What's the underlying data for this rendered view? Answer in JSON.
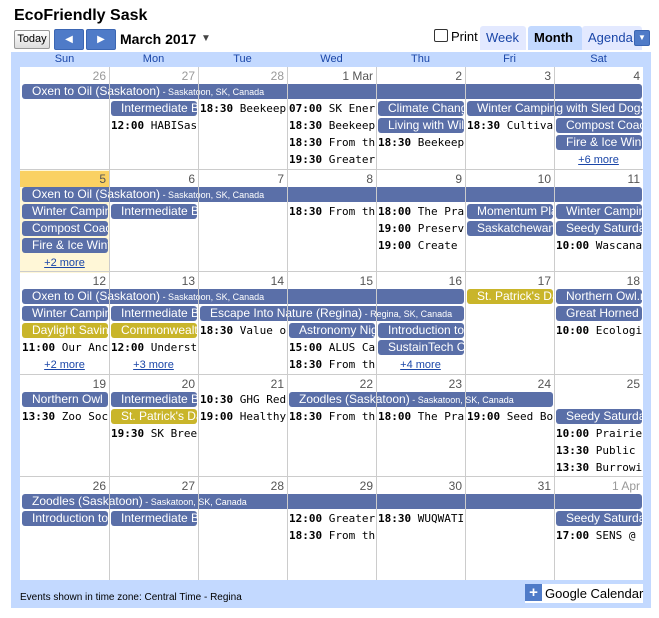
{
  "header": {
    "title": "EcoFriendly Sask"
  },
  "toolbar": {
    "today_label": "Today",
    "prev_icon": "◀",
    "next_icon": "▶",
    "current_period": "March 2017",
    "period_dropdown_icon": "▼",
    "print_label": "Print",
    "tabs": {
      "week": "Week",
      "month": "Month",
      "agenda": "Agenda"
    },
    "view_dropdown_icon": "▼"
  },
  "weekdays": [
    "Sun",
    "Mon",
    "Tue",
    "Wed",
    "Thu",
    "Fri",
    "Sat"
  ],
  "weeks": [
    {
      "days": [
        "26",
        "27",
        "28",
        "1 Mar",
        "2",
        "3",
        "4"
      ],
      "other_month": [
        true,
        true,
        true,
        false,
        false,
        false,
        false
      ],
      "today_index": -1,
      "items": [
        {
          "kind": "bar",
          "col": 0,
          "span": 7,
          "row": 0,
          "title": "Oxen to Oil (Saskatoon)",
          "loc": " - Saskatoon, SK, Canada",
          "color": "blue"
        },
        {
          "kind": "bar",
          "col": 1,
          "span": 1,
          "row": 1,
          "title": "Intermediate Beekeeping",
          "color": "blue"
        },
        {
          "kind": "time",
          "col": 2,
          "row": 1,
          "time": "18:30",
          "text": "Beekeeping"
        },
        {
          "kind": "time",
          "col": 3,
          "row": 1,
          "time": "07:00",
          "text": "SK Energy"
        },
        {
          "kind": "bar",
          "col": 4,
          "span": 1,
          "row": 1,
          "title": "Climate Change",
          "color": "blue"
        },
        {
          "kind": "bar",
          "col": 5,
          "span": 2,
          "row": 1,
          "title": "Winter Camping with Sled Dogs",
          "color": "blue"
        },
        {
          "kind": "time",
          "col": 1,
          "row": 2,
          "time": "12:00",
          "text": "HABISask"
        },
        {
          "kind": "time",
          "col": 3,
          "row": 2,
          "time": "18:30",
          "text": "Beekeeping"
        },
        {
          "kind": "bar",
          "col": 4,
          "span": 1,
          "row": 2,
          "title": "Living with Wildlife",
          "color": "blue"
        },
        {
          "kind": "time",
          "col": 5,
          "row": 2,
          "time": "18:30",
          "text": "Cultivating"
        },
        {
          "kind": "bar",
          "col": 6,
          "span": 1,
          "row": 2,
          "title": "Compost Coaching",
          "color": "blue"
        },
        {
          "kind": "time",
          "col": 3,
          "row": 3,
          "time": "18:30",
          "text": "From the"
        },
        {
          "kind": "time",
          "col": 4,
          "row": 3,
          "time": "18:30",
          "text": "Beekeeping"
        },
        {
          "kind": "bar",
          "col": 6,
          "span": 1,
          "row": 3,
          "title": "Fire & Ice Winter",
          "color": "blue"
        },
        {
          "kind": "time",
          "col": 3,
          "row": 4,
          "time": "19:30",
          "text": "Greater S"
        },
        {
          "kind": "more",
          "col": 6,
          "row": 4,
          "text": "+6 more"
        }
      ]
    },
    {
      "days": [
        "5",
        "6",
        "7",
        "8",
        "9",
        "10",
        "11"
      ],
      "other_month": [
        false,
        false,
        false,
        false,
        false,
        false,
        false
      ],
      "today_index": 0,
      "items": [
        {
          "kind": "bar",
          "col": 0,
          "span": 7,
          "row": 0,
          "title": "Oxen to Oil (Saskatoon)",
          "loc": " - Saskatoon, SK, Canada",
          "color": "blue"
        },
        {
          "kind": "bar",
          "col": 0,
          "span": 1,
          "row": 1,
          "title": "Winter Camping",
          "color": "blue"
        },
        {
          "kind": "bar",
          "col": 1,
          "span": 1,
          "row": 1,
          "title": "Intermediate Beekeeping",
          "color": "blue"
        },
        {
          "kind": "time",
          "col": 3,
          "row": 1,
          "time": "18:30",
          "text": "From the"
        },
        {
          "kind": "time",
          "col": 4,
          "row": 1,
          "time": "18:00",
          "text": "The Prairie"
        },
        {
          "kind": "bar",
          "col": 5,
          "span": 1,
          "row": 1,
          "title": "Momentum Planet",
          "color": "blue"
        },
        {
          "kind": "bar",
          "col": 6,
          "span": 1,
          "row": 1,
          "title": "Winter Camping",
          "color": "blue"
        },
        {
          "kind": "bar",
          "col": 0,
          "span": 1,
          "row": 2,
          "title": "Compost Coaching",
          "color": "blue"
        },
        {
          "kind": "time",
          "col": 4,
          "row": 2,
          "time": "19:00",
          "text": "Preserving"
        },
        {
          "kind": "bar",
          "col": 5,
          "span": 1,
          "row": 2,
          "title": "Saskatchewan",
          "color": "blue"
        },
        {
          "kind": "bar",
          "col": 6,
          "span": 1,
          "row": 2,
          "title": "Seedy Saturday",
          "color": "blue"
        },
        {
          "kind": "bar",
          "col": 0,
          "span": 1,
          "row": 3,
          "title": "Fire & Ice Winter",
          "color": "blue"
        },
        {
          "kind": "time",
          "col": 4,
          "row": 3,
          "time": "19:00",
          "text": "Create a Po"
        },
        {
          "kind": "time",
          "col": 6,
          "row": 3,
          "time": "10:00",
          "text": "Wascana Wi"
        },
        {
          "kind": "more",
          "col": 0,
          "row": 4,
          "text": "+2 more"
        }
      ]
    },
    {
      "days": [
        "12",
        "13",
        "14",
        "15",
        "16",
        "17",
        "18"
      ],
      "other_month": [
        false,
        false,
        false,
        false,
        false,
        false,
        false
      ],
      "today_index": -1,
      "items": [
        {
          "kind": "bar",
          "col": 0,
          "span": 5,
          "row": 0,
          "title": "Oxen to Oil (Saskatoon)",
          "loc": " - Saskatoon, SK, Canada",
          "color": "blue"
        },
        {
          "kind": "bar",
          "col": 5,
          "span": 1,
          "row": 0,
          "title": "St. Patrick's Day",
          "color": "gold"
        },
        {
          "kind": "bar",
          "col": 6,
          "span": 1,
          "row": 0,
          "title": "Northern Owl.ne",
          "color": "blue"
        },
        {
          "kind": "bar",
          "col": 0,
          "span": 1,
          "row": 1,
          "title": "Winter Camping",
          "color": "blue"
        },
        {
          "kind": "bar",
          "col": 1,
          "span": 1,
          "row": 1,
          "title": "Intermediate Beekeeping",
          "color": "blue"
        },
        {
          "kind": "bar",
          "col": 2,
          "span": 3,
          "row": 1,
          "title": "Escape Into Nature (Regina)",
          "loc": " - Regina, SK, Canada",
          "color": "blue"
        },
        {
          "kind": "bar",
          "col": 6,
          "span": 1,
          "row": 1,
          "title": "Great Horned Owl",
          "color": "blue"
        },
        {
          "kind": "bar",
          "col": 0,
          "span": 1,
          "row": 2,
          "title": "Daylight Saving Time",
          "color": "gold"
        },
        {
          "kind": "bar",
          "col": 1,
          "span": 1,
          "row": 2,
          "title": "Commonwealth Day",
          "color": "gold"
        },
        {
          "kind": "time",
          "col": 2,
          "row": 2,
          "time": "18:30",
          "text": "Value of W"
        },
        {
          "kind": "bar",
          "col": 3,
          "span": 1,
          "row": 2,
          "title": "Astronomy Night",
          "color": "blue"
        },
        {
          "kind": "bar",
          "col": 4,
          "span": 1,
          "row": 2,
          "title": "Introduction to",
          "color": "blue"
        },
        {
          "kind": "time",
          "col": 6,
          "row": 2,
          "time": "10:00",
          "text": "Ecological"
        },
        {
          "kind": "time",
          "col": 0,
          "row": 3,
          "time": "11:00",
          "text": "Our Ancient"
        },
        {
          "kind": "time",
          "col": 1,
          "row": 3,
          "time": "12:00",
          "text": "Understand"
        },
        {
          "kind": "time",
          "col": 3,
          "row": 3,
          "time": "15:00",
          "text": "ALUS Can"
        },
        {
          "kind": "bar",
          "col": 4,
          "span": 1,
          "row": 3,
          "title": "SustainTech Conf",
          "color": "blue"
        },
        {
          "kind": "more",
          "col": 0,
          "row": 4,
          "text": "+2 more"
        },
        {
          "kind": "more",
          "col": 1,
          "row": 4,
          "text": "+3 more"
        },
        {
          "kind": "time",
          "col": 3,
          "row": 4,
          "time": "18:30",
          "text": "From the"
        },
        {
          "kind": "more",
          "col": 4,
          "row": 4,
          "text": "+4 more"
        }
      ]
    },
    {
      "days": [
        "19",
        "20",
        "21",
        "22",
        "23",
        "24",
        "25"
      ],
      "other_month": [
        false,
        false,
        false,
        false,
        false,
        false,
        false
      ],
      "today_index": -1,
      "items": [
        {
          "kind": "bar",
          "col": 0,
          "span": 1,
          "row": 0,
          "title": "Northern Owl",
          "color": "blue"
        },
        {
          "kind": "bar",
          "col": 1,
          "span": 1,
          "row": 0,
          "title": "Intermediate Beekeeping",
          "color": "blue"
        },
        {
          "kind": "time",
          "col": 2,
          "row": 0,
          "time": "10:30",
          "text": "GHG Reduc"
        },
        {
          "kind": "bar",
          "col": 3,
          "span": 3,
          "row": 0,
          "title": "Zoodles (Saskatoon)",
          "loc": " - Saskatoon, SK, Canada",
          "color": "blue"
        },
        {
          "kind": "time",
          "col": 0,
          "row": 1,
          "time": "13:30",
          "text": "Zoo Society"
        },
        {
          "kind": "bar",
          "col": 1,
          "span": 1,
          "row": 1,
          "title": "St. Patrick's Day",
          "color": "gold"
        },
        {
          "kind": "time",
          "col": 2,
          "row": 1,
          "time": "19:00",
          "text": "Healthy Ya"
        },
        {
          "kind": "time",
          "col": 3,
          "row": 1,
          "time": "18:30",
          "text": "From the"
        },
        {
          "kind": "time",
          "col": 4,
          "row": 1,
          "time": "18:00",
          "text": "The Prairie"
        },
        {
          "kind": "time",
          "col": 5,
          "row": 1,
          "time": "19:00",
          "text": "Seed Bomb"
        },
        {
          "kind": "bar",
          "col": 6,
          "span": 1,
          "row": 1,
          "title": "Seedy Saturday",
          "color": "blue"
        },
        {
          "kind": "time",
          "col": 1,
          "row": 2,
          "time": "19:30",
          "text": "SK Breed"
        },
        {
          "kind": "time",
          "col": 6,
          "row": 2,
          "time": "10:00",
          "text": "Prairie Bir"
        },
        {
          "kind": "time",
          "col": 6,
          "row": 3,
          "time": "13:30",
          "text": "Public Pas"
        },
        {
          "kind": "time",
          "col": 6,
          "row": 4,
          "time": "13:30",
          "text": "Burrowing"
        }
      ]
    },
    {
      "days": [
        "26",
        "27",
        "28",
        "29",
        "30",
        "31",
        "1 Apr"
      ],
      "other_month": [
        false,
        false,
        false,
        false,
        false,
        false,
        true
      ],
      "today_index": -1,
      "items": [
        {
          "kind": "bar",
          "col": 0,
          "span": 7,
          "row": 0,
          "title": "Zoodles (Saskatoon)",
          "loc": " - Saskatoon, SK, Canada",
          "color": "blue"
        },
        {
          "kind": "bar",
          "col": 0,
          "span": 1,
          "row": 1,
          "title": "Introduction to",
          "color": "blue"
        },
        {
          "kind": "bar",
          "col": 1,
          "span": 1,
          "row": 1,
          "title": "Intermediate Beekeeping",
          "color": "blue"
        },
        {
          "kind": "time",
          "col": 3,
          "row": 1,
          "time": "12:00",
          "text": "Greater S"
        },
        {
          "kind": "time",
          "col": 4,
          "row": 1,
          "time": "18:30",
          "text": "WUQWATI"
        },
        {
          "kind": "bar",
          "col": 6,
          "span": 1,
          "row": 1,
          "title": "Seedy Saturday",
          "color": "blue"
        },
        {
          "kind": "time",
          "col": 3,
          "row": 2,
          "time": "18:30",
          "text": "From the"
        },
        {
          "kind": "time",
          "col": 6,
          "row": 2,
          "time": "17:00",
          "text": "SENS @ 1"
        }
      ]
    }
  ],
  "footer": {
    "timezone_note": "Events shown in time zone: Central Time - Regina",
    "gcal_plus": "+",
    "gcal_label": "Google Calendar"
  }
}
